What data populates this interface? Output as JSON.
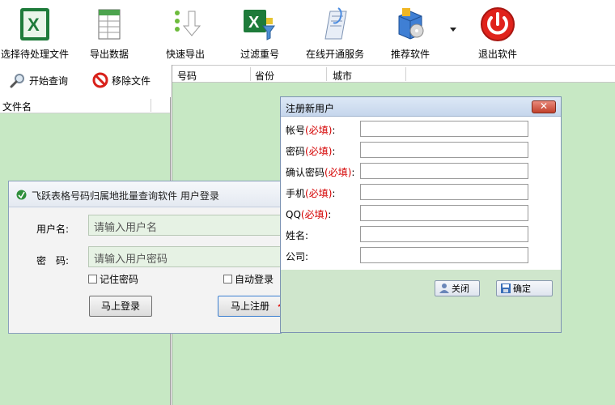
{
  "toolbar": {
    "items": [
      {
        "label": "选择待处理文件",
        "icon": "excel-icon"
      },
      {
        "label": "导出数据",
        "icon": "spreadsheet-icon"
      },
      {
        "label": "快速导出",
        "icon": "quick-export-icon"
      },
      {
        "label": "过滤重号",
        "icon": "filter-excel-icon"
      },
      {
        "label": "在线开通服务",
        "icon": "service-icon"
      },
      {
        "label": "推荐软件",
        "icon": "software-box-icon"
      },
      {
        "label": "退出软件",
        "icon": "power-icon"
      }
    ]
  },
  "left": {
    "start_query": "开始查询",
    "remove_file": "移除文件",
    "file_col": "文件名"
  },
  "grid": {
    "columns": [
      "号码",
      "省份",
      "城市"
    ]
  },
  "login": {
    "title": "飞跃表格号码归属地批量查询软件 用户登录",
    "username_label": "用户名:",
    "username_placeholder": "请输入用户名",
    "password_label": "密　码:",
    "password_placeholder": "请输入用户密码",
    "remember": "记住密码",
    "autologin": "自动登录",
    "login_btn": "马上登录",
    "register_btn": "马上注册"
  },
  "register": {
    "title": "注册新用户",
    "fields": [
      {
        "label": "帐号",
        "req": "(必填)",
        "colon": ":"
      },
      {
        "label": "密码",
        "req": "(必填)",
        "colon": ":"
      },
      {
        "label": "确认密码",
        "req": "(必填)",
        "colon": ":"
      },
      {
        "label": "手机",
        "req": "(必填)",
        "colon": ":"
      },
      {
        "label": "QQ",
        "req": "(必填)",
        "colon": ":"
      },
      {
        "label": "姓名:",
        "req": "",
        "colon": ""
      },
      {
        "label": "公司:",
        "req": "",
        "colon": ""
      }
    ],
    "close_btn": "关闭",
    "ok_btn": "确定"
  },
  "colors": {
    "grid_bg": "#c7e8c4",
    "required_red": "#d40000",
    "arrow_red": "#e0201c"
  }
}
